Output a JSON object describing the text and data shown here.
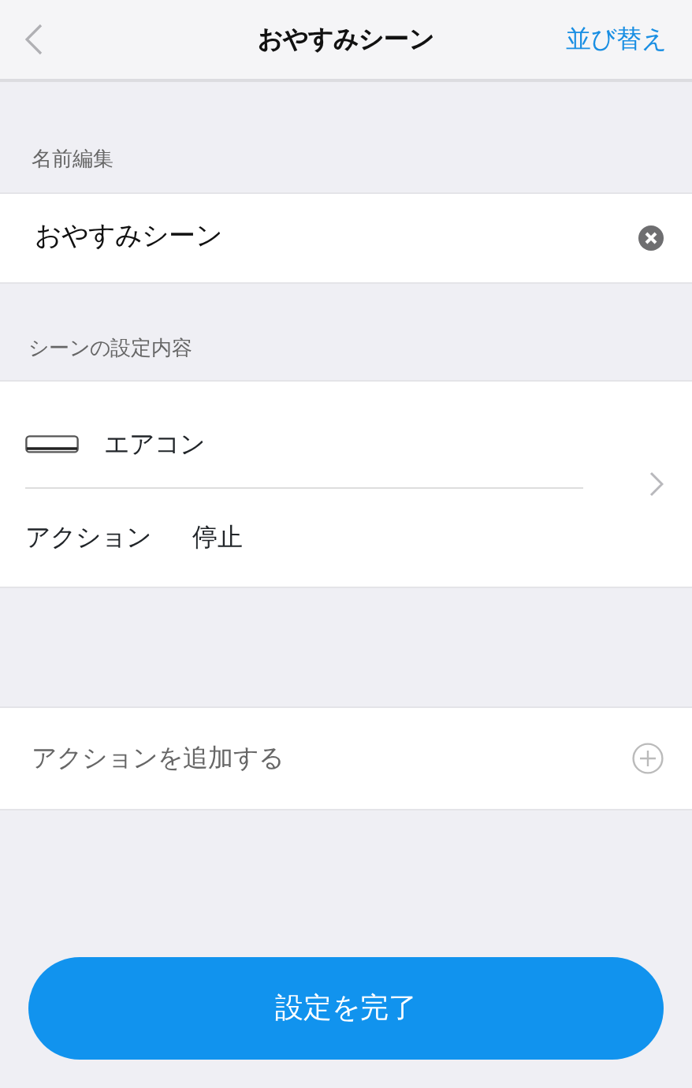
{
  "nav": {
    "title": "おやすみシーン",
    "action": "並び替え"
  },
  "name_section": {
    "label": "名前編集",
    "value": "おやすみシーン"
  },
  "scene_section": {
    "label": "シーンの設定内容",
    "items": [
      {
        "device": "エアコン",
        "action_label": "アクション",
        "action_value": "停止"
      }
    ]
  },
  "add_action": {
    "label": "アクションを追加する"
  },
  "done_button": {
    "label": "設定を完了"
  }
}
